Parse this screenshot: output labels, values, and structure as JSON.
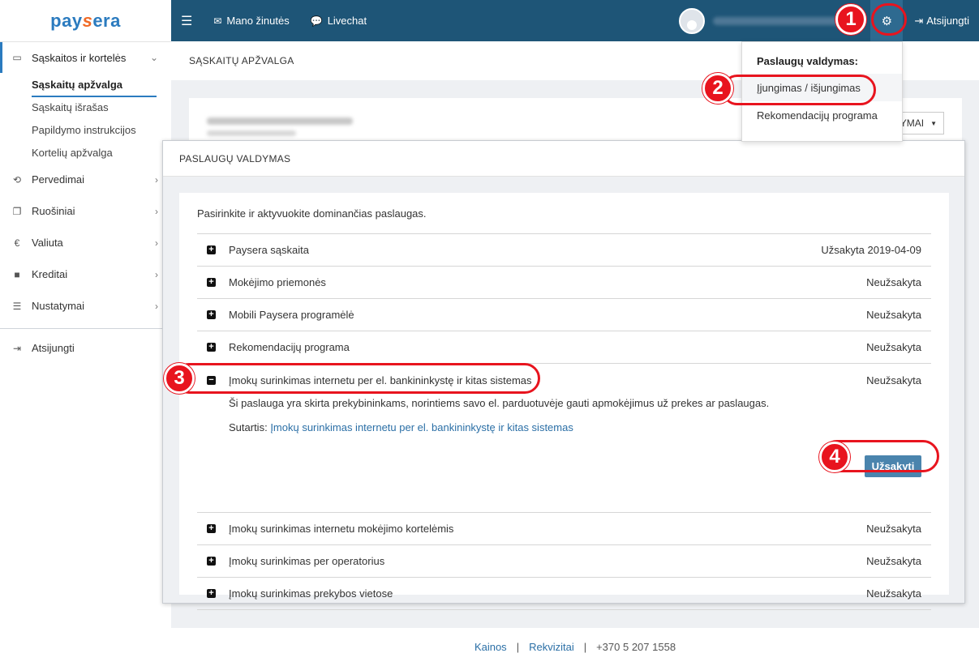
{
  "brand": {
    "logo_prefix": "pay",
    "logo_s": "s",
    "logo_suffix": "era"
  },
  "sidebar": {
    "accounts": {
      "label": "Sąskaitos ir kortelės"
    },
    "sub_items": [
      {
        "label": "Sąskaitų apžvalga"
      },
      {
        "label": "Sąskaitų išrašas"
      },
      {
        "label": "Papildymo instrukcijos"
      },
      {
        "label": "Kortelių apžvalga"
      }
    ],
    "items": [
      {
        "label": "Pervedimai"
      },
      {
        "label": "Ruošiniai"
      },
      {
        "label": "Valiuta"
      },
      {
        "label": "Kreditai"
      },
      {
        "label": "Nustatymai"
      }
    ],
    "logout": "Atsijungti"
  },
  "topbar": {
    "messages": "Mano žinutės",
    "livechat": "Livechat",
    "logout": "Atsijungti"
  },
  "page": {
    "title": "SĄSKAITŲ APŽVALGA",
    "select_label": "YMAI"
  },
  "dropdown": {
    "title": "Paslaugų valdymas:",
    "items": [
      {
        "label": "Įjungimas / išjungimas"
      },
      {
        "label": "Rekomendacijų programa"
      }
    ]
  },
  "modal": {
    "title": "PASLAUGŲ VALDYMAS",
    "intro": "Pasirinkite ir aktyvuokite dominančias paslaugas.",
    "services": [
      {
        "name": "Paysera sąskaita",
        "status": "Užsakyta 2019-04-09"
      },
      {
        "name": "Mokėjimo priemonės",
        "status": "Neužsakyta"
      },
      {
        "name": "Mobili Paysera programėlė",
        "status": "Neužsakyta"
      },
      {
        "name": "Rekomendacijų programa",
        "status": "Neužsakyta"
      },
      {
        "name": "Įmokų surinkimas internetu per el. bankininkystę ir kitas sistemas",
        "status": "Neužsakyta"
      },
      {
        "name": "Įmokų surinkimas internetu mokėjimo kortelėmis",
        "status": "Neužsakyta"
      },
      {
        "name": "Įmokų surinkimas per operatorius",
        "status": "Neužsakyta"
      },
      {
        "name": "Įmokų surinkimas prekybos vietose",
        "status": "Neužsakyta"
      }
    ],
    "expanded": {
      "description": "Ši paslauga yra skirta prekybininkams, norintiems savo el. parduotuvėje gauti apmokėjimus už prekes ar paslaugas.",
      "contract_label": "Sutartis:",
      "contract_link": "Įmokų surinkimas internetu per el. bankininkystę ir kitas sistemas",
      "order_button": "Užsakyti"
    }
  },
  "footer": {
    "prices": "Kainos",
    "details": "Rekvizitai",
    "phone": "+370 5 207 1558",
    "separator": "|"
  },
  "annotations": {
    "step1": "1",
    "step2": "2",
    "step3": "3",
    "step4": "4"
  },
  "colors": {
    "topbar": "#1e5577",
    "accent": "#2b7bbf",
    "button": "#4a84ad",
    "annotation": "#e8141e"
  }
}
